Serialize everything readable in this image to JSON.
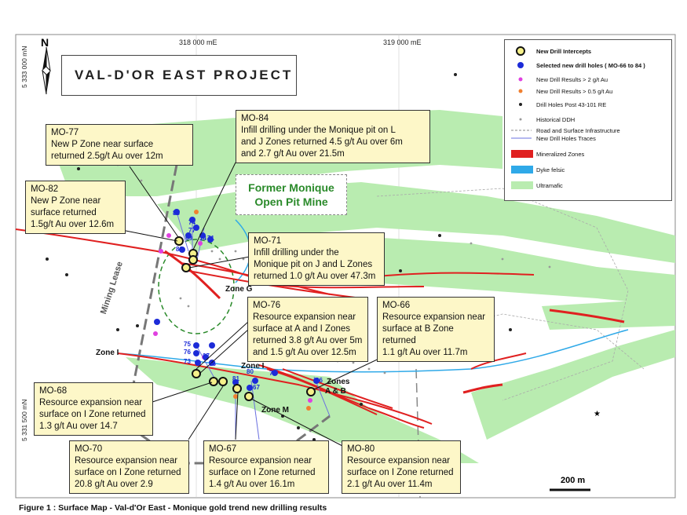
{
  "title": "VAL-D'OR EAST PROJECT",
  "caption": "Figure 1 : Surface Map - Val-d'Or East - Monique gold trend new drilling results",
  "coordinates": {
    "easting_left": "318 000 mE",
    "easting_right": "319 000 mE",
    "northing_top": "5 333 000 mN",
    "northing_bottom": "5 331 500 mN"
  },
  "north_arrow": "N",
  "scale_bar": "200 m",
  "former_pit": {
    "line1": "Former Monique",
    "line2": "Open Pit Mine"
  },
  "map_labels": {
    "mining_lease": "Mining Lease",
    "zone_g": "Zone G",
    "zone_i_left": "Zone I",
    "zone_i_center": "Zone I",
    "zone_m": "Zone M",
    "zones_ab_1": "Zones",
    "zones_ab_2": "A & B"
  },
  "hole_labels": [
    "83",
    "74",
    "77",
    "69",
    "14",
    "71",
    "82",
    "75",
    "76",
    "27",
    "73",
    "56",
    "80",
    "81",
    "67",
    "79",
    "66"
  ],
  "legend": {
    "items": [
      {
        "label": "New Drill Intercepts",
        "symbol": "yellow-ring"
      },
      {
        "label": "Selected new drill holes ( MO-66 to 84 )",
        "symbol": "blue-dot"
      },
      {
        "label": "New Drill Results > 2 g/t Au",
        "symbol": "magenta-dot"
      },
      {
        "label": "New Drill Results > 0.5 g/t Au",
        "symbol": "orange-dot"
      },
      {
        "label": "Drill Holes Post 43-101 RE",
        "symbol": "black-dot"
      },
      {
        "label": "Historical DDH",
        "symbol": "grey-dot"
      },
      {
        "label": "Road and Surface Infrastructure",
        "symbol": "dashed-line"
      },
      {
        "label": "New Drill Holes Traces",
        "symbol": "blue-line"
      },
      {
        "label": "Mineralized Zones",
        "symbol": "red-fill"
      },
      {
        "label": "Dyke felsic",
        "symbol": "cyan-fill"
      },
      {
        "label": "Ultramafic",
        "symbol": "green-fill"
      }
    ],
    "colors": {
      "ultramafic": "#b9ecb0",
      "dyke": "#2fa9e8",
      "mineralized": "#e02020",
      "intercept": "#f5f08a",
      "hole": "#1c2bd8"
    }
  },
  "callouts": [
    {
      "id": "MO-77",
      "lines": [
        "MO-77",
        "New P Zone near surface",
        "returned 2.5g/t Au over 12m"
      ]
    },
    {
      "id": "MO-84",
      "lines": [
        "MO-84",
        "Infill drilling under the Monique pit on L",
        "and J Zones returned 4.5 g/t Au over 6m",
        "and 2.7 g/t Au over 21.5m"
      ]
    },
    {
      "id": "MO-82",
      "lines": [
        "MO-82",
        "New P Zone near",
        "surface returned",
        "1.5g/t Au over 12.6m"
      ]
    },
    {
      "id": "MO-71",
      "lines": [
        "MO-71",
        "Infill drilling under the",
        "Monique pit on J and L Zones",
        "returned 1.0 g/t Au over 47.3m"
      ]
    },
    {
      "id": "MO-76",
      "lines": [
        "MO-76",
        "Resource expansion near",
        "surface at A and I Zones",
        "returned 3.8 g/t Au over 5m",
        "and 1.5 g/t Au over 12.5m"
      ]
    },
    {
      "id": "MO-66",
      "lines": [
        "MO-66",
        "Resource expansion near",
        "surface at B Zone returned",
        "1.1 g/t Au over 11.7m"
      ]
    },
    {
      "id": "MO-68",
      "lines": [
        "MO-68",
        "Resource expansion near",
        "surface on I Zone returned",
        "1.3 g/t Au over 14.7"
      ]
    },
    {
      "id": "MO-70",
      "lines": [
        "MO-70",
        "Resource expansion near",
        "surface on I Zone returned",
        "20.8 g/t Au over 2.9"
      ]
    },
    {
      "id": "MO-67",
      "lines": [
        "MO-67",
        "Resource expansion near",
        "surface on I Zone returned",
        "1.4 g/t Au over 16.1m"
      ]
    },
    {
      "id": "MO-80",
      "lines": [
        "MO-80",
        "Resource expansion near",
        "surface on I Zone returned",
        "2.1 g/t Au over 11.4m"
      ]
    }
  ]
}
